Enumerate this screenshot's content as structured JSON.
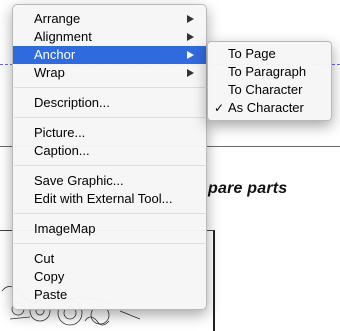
{
  "document": {
    "heading_fragment": "pare parts"
  },
  "context_menu": {
    "items": [
      {
        "label": "Arrange",
        "submenu": true
      },
      {
        "label": "Alignment",
        "submenu": true
      },
      {
        "label": "Anchor",
        "submenu": true,
        "selected": true
      },
      {
        "label": "Wrap",
        "submenu": true
      },
      {
        "label": "Description..."
      },
      {
        "label": "Picture..."
      },
      {
        "label": "Caption..."
      },
      {
        "label": "Save Graphic..."
      },
      {
        "label": "Edit with External Tool..."
      },
      {
        "label": "ImageMap"
      },
      {
        "label": "Cut"
      },
      {
        "label": "Copy"
      },
      {
        "label": "Paste"
      }
    ]
  },
  "anchor_submenu": {
    "items": [
      {
        "label": "To Page"
      },
      {
        "label": "To Paragraph"
      },
      {
        "label": "To Character"
      },
      {
        "label": "As Character",
        "checked": true
      }
    ],
    "check_glyph": "✓"
  },
  "colors": {
    "selection": "#2f6bde"
  }
}
